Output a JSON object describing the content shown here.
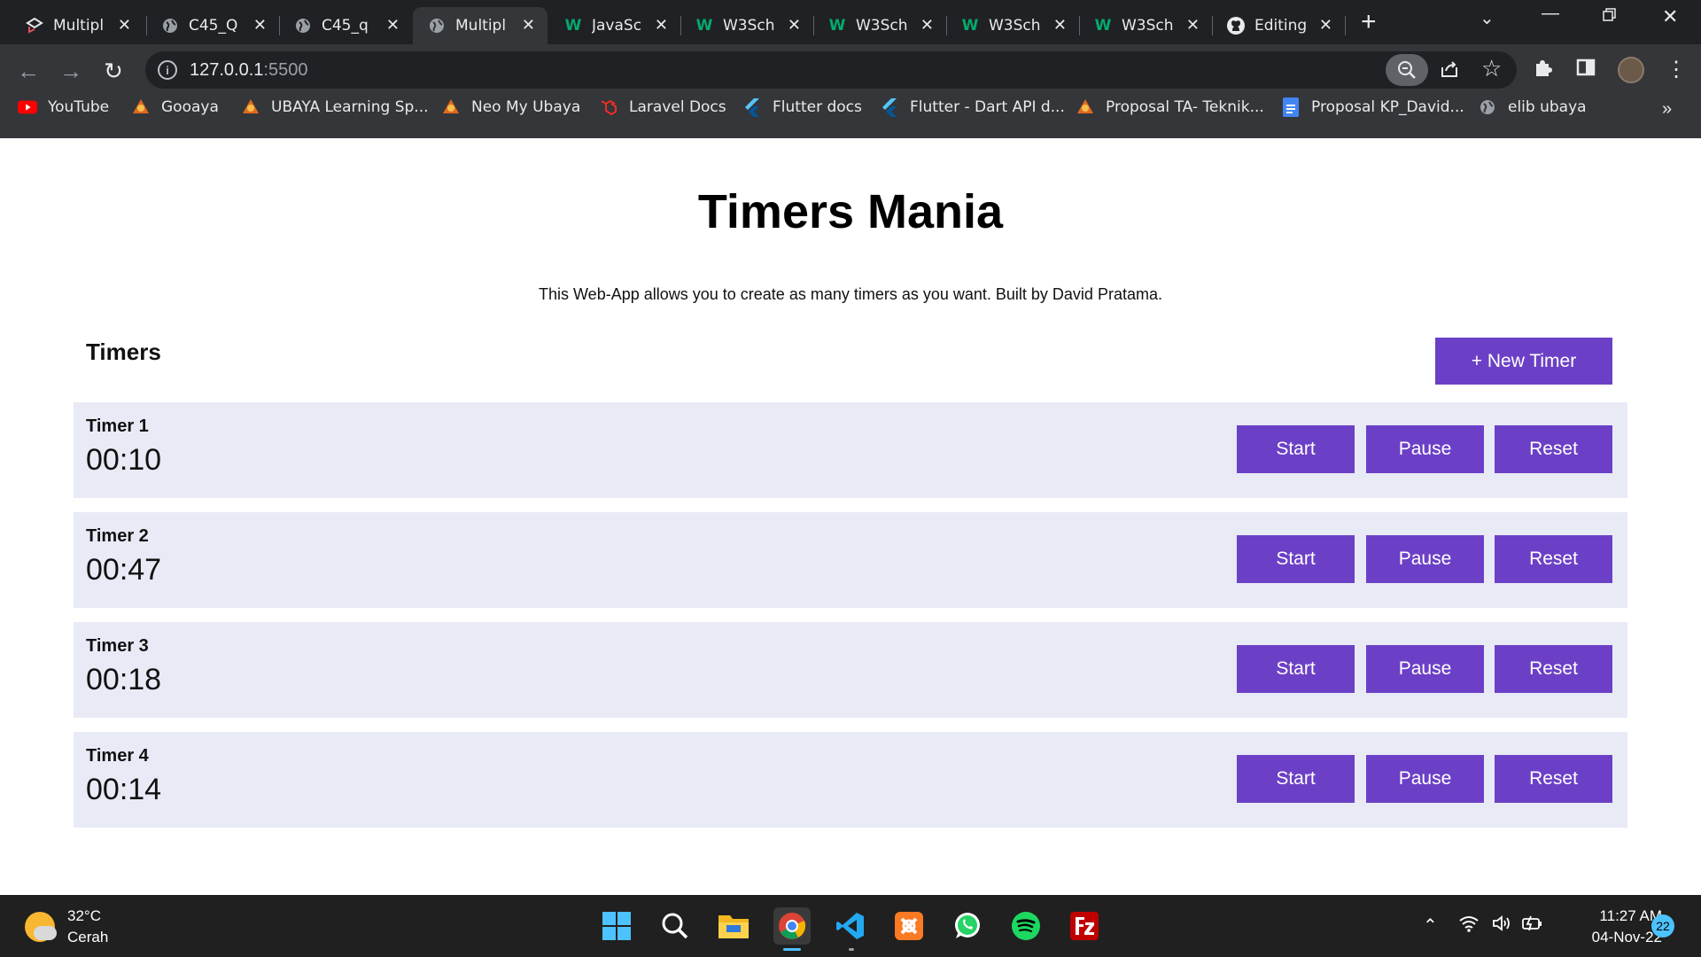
{
  "browser": {
    "tabs": [
      {
        "label": "Multipl",
        "icon": "app-logo-icon"
      },
      {
        "label": "C45_Q",
        "icon": "globe-icon"
      },
      {
        "label": "C45_q",
        "icon": "globe-icon"
      },
      {
        "label": "Multipl",
        "icon": "globe-icon",
        "active": true
      },
      {
        "label": "JavaSc",
        "icon": "w3schools-icon"
      },
      {
        "label": "W3Sch",
        "icon": "w3schools-icon"
      },
      {
        "label": "W3Sch",
        "icon": "w3schools-icon"
      },
      {
        "label": "W3Sch",
        "icon": "w3schools-icon"
      },
      {
        "label": "W3Sch",
        "icon": "w3schools-icon"
      },
      {
        "label": "Editing",
        "icon": "github-icon"
      }
    ],
    "url_host": "127.0.0.1",
    "url_port": ":5500",
    "bookmarks": [
      {
        "label": "YouTube",
        "icon": "youtube-icon"
      },
      {
        "label": "Gooaya",
        "icon": "ubaya-icon"
      },
      {
        "label": "UBAYA Learning Sp...",
        "icon": "ubaya-icon"
      },
      {
        "label": "Neo My Ubaya",
        "icon": "ubaya-icon"
      },
      {
        "label": "Laravel Docs",
        "icon": "laravel-icon"
      },
      {
        "label": "Flutter docs",
        "icon": "flutter-icon"
      },
      {
        "label": "Flutter - Dart API d...",
        "icon": "flutter-icon"
      },
      {
        "label": "Proposal TA- Teknik...",
        "icon": "ubaya-icon"
      },
      {
        "label": "Proposal KP_David...",
        "icon": "google-docs-icon"
      },
      {
        "label": "elib ubaya",
        "icon": "globe-icon"
      }
    ],
    "bookmarks_more": "»"
  },
  "page": {
    "title": "Timers Mania",
    "description": "This Web-App allows you to create as many timers as you want. Built by David Pratama.",
    "section_title": "Timers",
    "new_timer_label": "+ New Timer",
    "timers": [
      {
        "name": "Timer 1",
        "time": "00:10",
        "start": "Start",
        "pause": "Pause",
        "reset": "Reset"
      },
      {
        "name": "Timer 2",
        "time": "00:47",
        "start": "Start",
        "pause": "Pause",
        "reset": "Reset"
      },
      {
        "name": "Timer 3",
        "time": "00:18",
        "start": "Start",
        "pause": "Pause",
        "reset": "Reset"
      },
      {
        "name": "Timer 4",
        "time": "00:14",
        "start": "Start",
        "pause": "Pause",
        "reset": "Reset"
      }
    ],
    "accent_color": "#6c40c6",
    "card_color": "#e8eaf6"
  },
  "taskbar": {
    "weather_temp": "32°C",
    "weather_desc": "Cerah",
    "time": "11:27 AM",
    "date": "04-Nov-22",
    "notifications": "22"
  }
}
